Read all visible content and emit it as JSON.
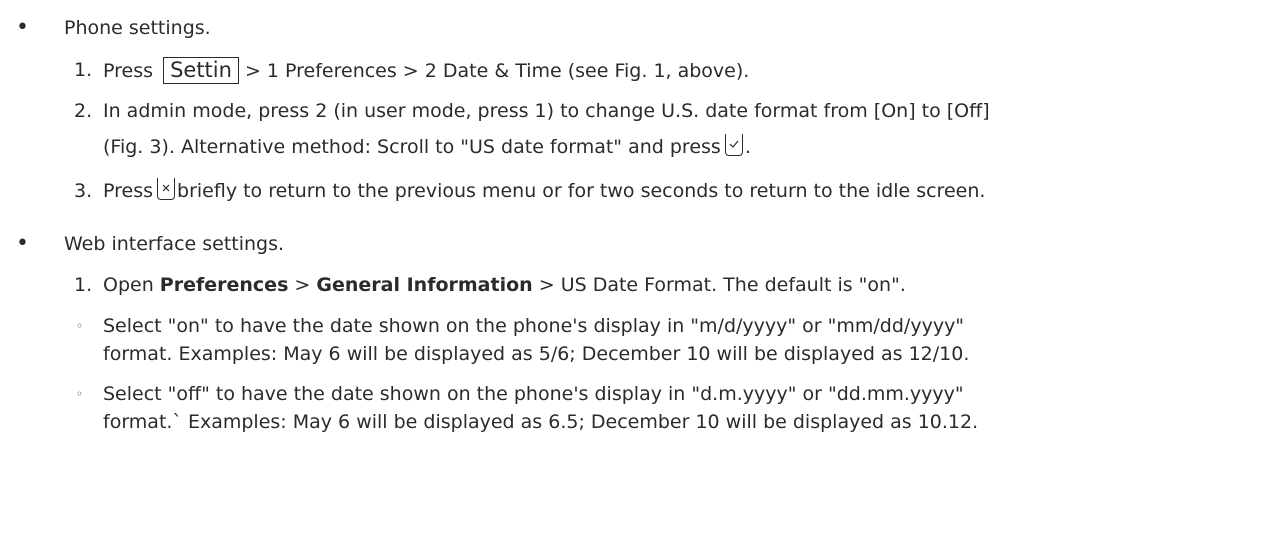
{
  "phone_section": {
    "bullet": "•",
    "title": "Phone settings.",
    "step1": {
      "num": "1.",
      "press": "Press",
      "key": "Settin",
      "rest": "> 1 Preferences  > 2 Date & Time (see Fig. 1, above)."
    },
    "step2": {
      "num": "2.",
      "line1": "In admin mode, press 2 (in user mode, press 1) to change U.S. date format from [On] to [Off]",
      "line2_pre": "(Fig. 3).  Alternative method:  Scroll to \"US date format\" and press",
      "line2_post": "."
    },
    "step3": {
      "num": "3.",
      "pre": "Press",
      "post": "briefly to return to the previous menu or for two seconds to return to the idle screen."
    }
  },
  "web_section": {
    "bullet": "•",
    "title": "Web interface settings.",
    "step1": {
      "num": "1.",
      "open": "Open",
      "pref": "Preferences",
      "sep1": ">",
      "gen": "General Information",
      "rest": "> US Date Format.  The default is \"on\"."
    },
    "sub_on": {
      "bullet": "◦",
      "line1": "Select \"on\" to have the date shown on the phone's display in \"m/d/yyyy\" or \"mm/dd/yyyy\"",
      "line2": "format.  Examples:  May 6 will be displayed as 5/6;  December 10 will be displayed as 12/10."
    },
    "sub_off": {
      "bullet": "◦",
      "line1": "Select \"off\" to have the date shown on the phone's display in \"d.m.yyyy\" or \"dd.mm.yyyy\"",
      "line2": "format.` Examples:  May 6 will be displayed as 6.5;  December 10 will be displayed as 10.12."
    }
  },
  "icons": {
    "confirm_key": "check-key-icon",
    "cancel_key": "x-key-icon"
  }
}
